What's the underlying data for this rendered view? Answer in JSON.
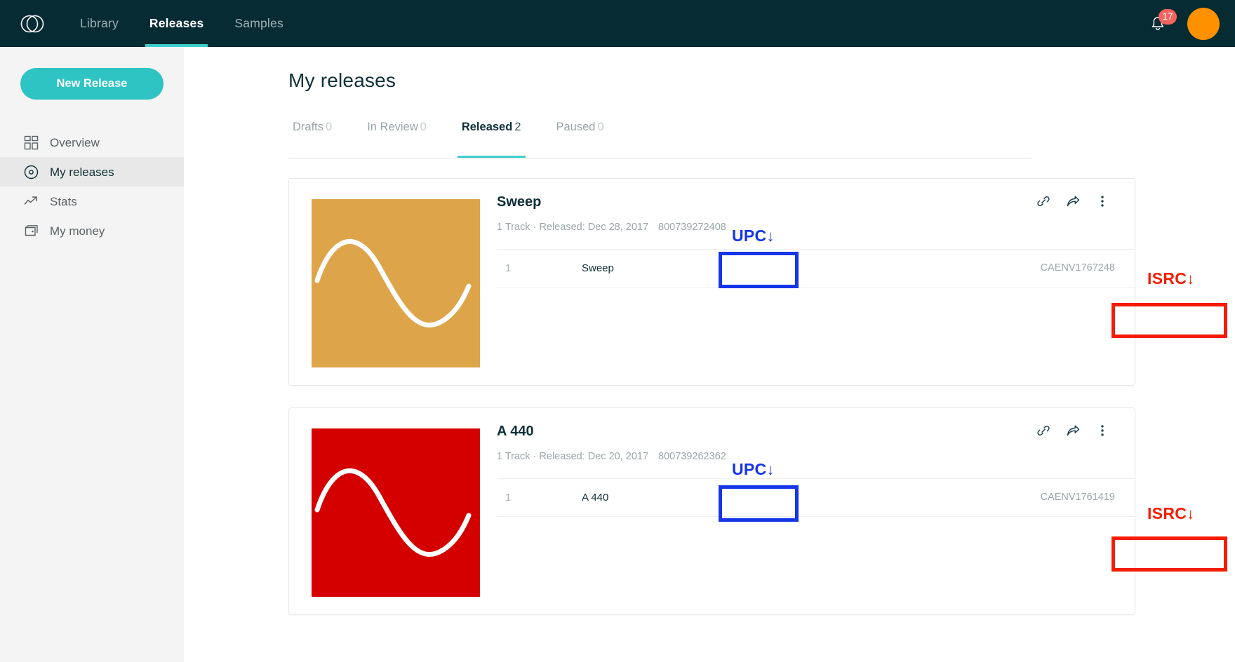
{
  "topnav": {
    "logo_name": "overlapping-circles-logo",
    "links": [
      {
        "label": "Library",
        "active": false
      },
      {
        "label": "Releases",
        "active": true
      },
      {
        "label": "Samples",
        "active": false
      }
    ],
    "notifications_count": "17",
    "bell_icon": "bell-icon",
    "avatar_color": "#ff9000"
  },
  "sidebar": {
    "new_release_label": "New Release",
    "items": [
      {
        "label": "Overview",
        "icon": "grid-icon",
        "active": false
      },
      {
        "label": "My releases",
        "icon": "disc-icon",
        "active": true
      },
      {
        "label": "Stats",
        "icon": "trending-up-icon",
        "active": false
      },
      {
        "label": "My money",
        "icon": "wallet-icon",
        "active": false
      }
    ]
  },
  "main": {
    "page_title": "My releases",
    "tabs": [
      {
        "label": "Drafts",
        "count": "0",
        "active": false
      },
      {
        "label": "In Review",
        "count": "0",
        "active": false
      },
      {
        "label": "Released",
        "count": "2",
        "active": true
      },
      {
        "label": "Paused",
        "count": "0",
        "active": false
      }
    ],
    "releases": [
      {
        "title": "Sweep",
        "meta": "1 Track · Released: Dec 28, 2017",
        "upc": "800739272408",
        "art_color": "#dda44a",
        "tracks": [
          {
            "num": "1",
            "name": "Sweep",
            "isrc": "CAENV1767248"
          }
        ],
        "actions": [
          {
            "icon": "link-icon"
          },
          {
            "icon": "share-icon"
          },
          {
            "icon": "more-vertical-icon"
          }
        ]
      },
      {
        "title": "A 440",
        "meta": "1 Track · Released: Dec 20, 2017",
        "upc": "800739262362",
        "art_color": "#d40000",
        "tracks": [
          {
            "num": "1",
            "name": "A 440",
            "isrc": "CAENV1761419"
          }
        ],
        "actions": [
          {
            "icon": "link-icon"
          },
          {
            "icon": "share-icon"
          },
          {
            "icon": "more-vertical-icon"
          }
        ]
      }
    ]
  },
  "annotations": {
    "upc_label": "UPC",
    "upc_arrow": "↓",
    "upc_color": "#1435e8",
    "isrc_label": "ISRC",
    "isrc_arrow": "↓",
    "isrc_color": "#f51c00"
  }
}
